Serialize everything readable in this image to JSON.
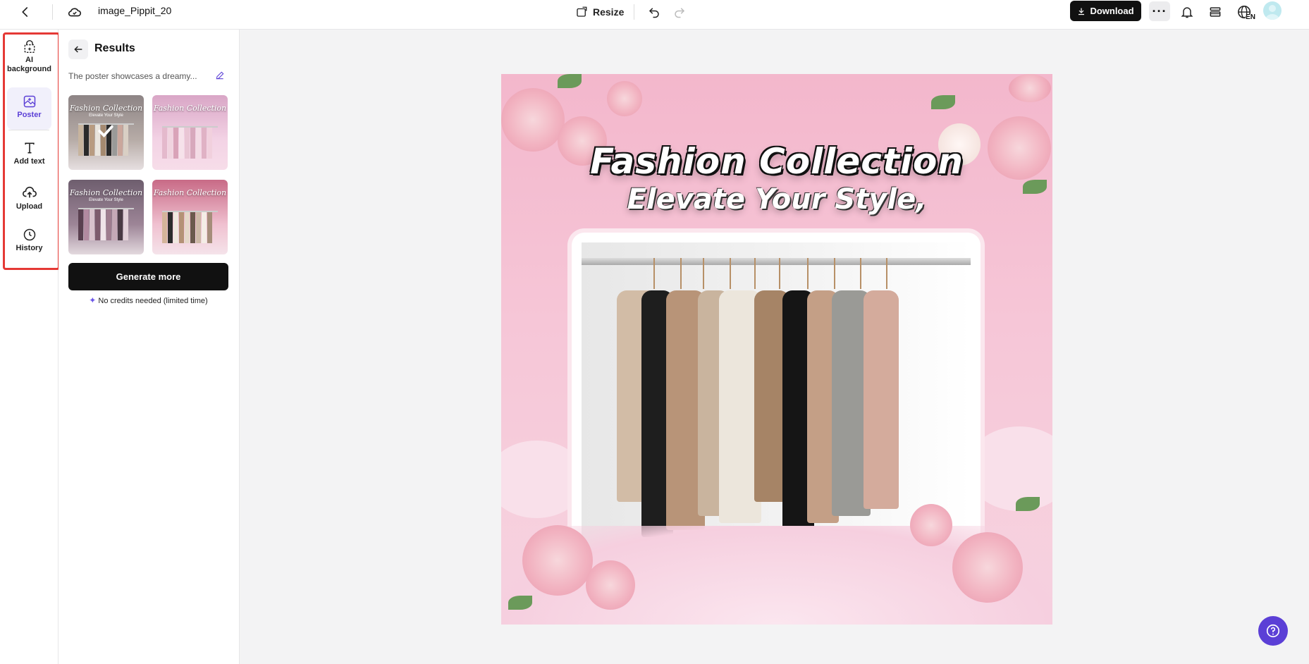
{
  "topbar": {
    "filename": "image_Pippit_20",
    "resize_label": "Resize",
    "download_label": "Download",
    "more_label": "···",
    "language": "EN"
  },
  "rail": {
    "items": [
      {
        "label": "AI background",
        "icon": "ai-background-icon"
      },
      {
        "label": "Poster",
        "icon": "poster-icon",
        "active": true
      },
      {
        "label": "Add text",
        "icon": "text-icon"
      },
      {
        "label": "Upload",
        "icon": "upload-icon"
      },
      {
        "label": "History",
        "icon": "history-icon"
      }
    ],
    "highlight_color": "#e53935"
  },
  "panel": {
    "title": "Results",
    "prompt": "The poster showcases a dreamy...",
    "results": [
      {
        "title": "Fashion Collection",
        "subtitle": "Elevate Your Style",
        "selected": true
      },
      {
        "title": "Fashion Collection",
        "subtitle": "",
        "selected": false
      },
      {
        "title": "Fashion Collection",
        "subtitle": "Elevate Your Style",
        "selected": false
      },
      {
        "title": "Fashion Collection",
        "subtitle": "",
        "selected": false
      }
    ],
    "generate_label": "Generate more",
    "credits_note": "No credits needed (limited time)"
  },
  "canvas": {
    "title": "Fashion Collection",
    "subtitle": "Elevate Your Style,"
  },
  "colors": {
    "accent": "#5b3fd6",
    "primary_button": "#111111",
    "canvas_pink": "#f3b7cc"
  }
}
